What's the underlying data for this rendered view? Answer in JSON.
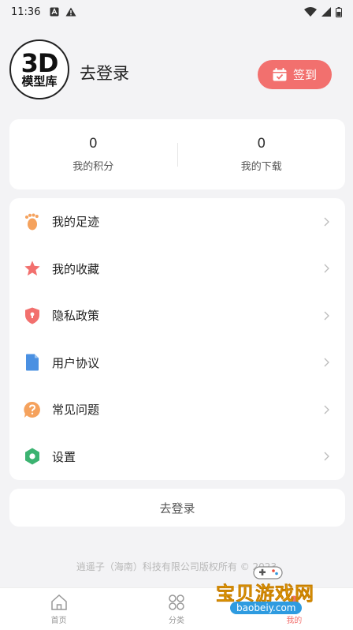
{
  "status_bar": {
    "time": "11:36"
  },
  "header": {
    "avatar_big": "3D",
    "avatar_small": "模型库",
    "login_title": "去登录",
    "checkin_label": "签到"
  },
  "stats": [
    {
      "value": "0",
      "label": "我的积分"
    },
    {
      "value": "0",
      "label": "我的下载"
    }
  ],
  "menu": {
    "items": [
      {
        "label": "我的足迹",
        "icon": "footprint-icon",
        "color": "#f5a25d"
      },
      {
        "label": "我的收藏",
        "icon": "star-icon",
        "color": "#f2706e"
      },
      {
        "label": "隐私政策",
        "icon": "shield-icon",
        "color": "#f2706e"
      },
      {
        "label": "用户协议",
        "icon": "document-icon",
        "color": "#4a90e2"
      },
      {
        "label": "常见问题",
        "icon": "question-icon",
        "color": "#f5a25d"
      },
      {
        "label": "设置",
        "icon": "gear-icon",
        "color": "#3cb371"
      }
    ]
  },
  "logout_label": "去登录",
  "copyright": "逍遥子（海南）科技有限公司版权所有 © 2023",
  "tabbar": {
    "tabs": [
      {
        "label": "首页",
        "icon": "home-icon"
      },
      {
        "label": "分类",
        "icon": "grid-icon"
      },
      {
        "label": "我的",
        "icon": "user-icon"
      }
    ]
  },
  "watermark": {
    "title": "宝贝游戏网",
    "url": "baobeiy.com"
  },
  "colors": {
    "accent": "#f2706e",
    "background": "#f3f3f5"
  }
}
